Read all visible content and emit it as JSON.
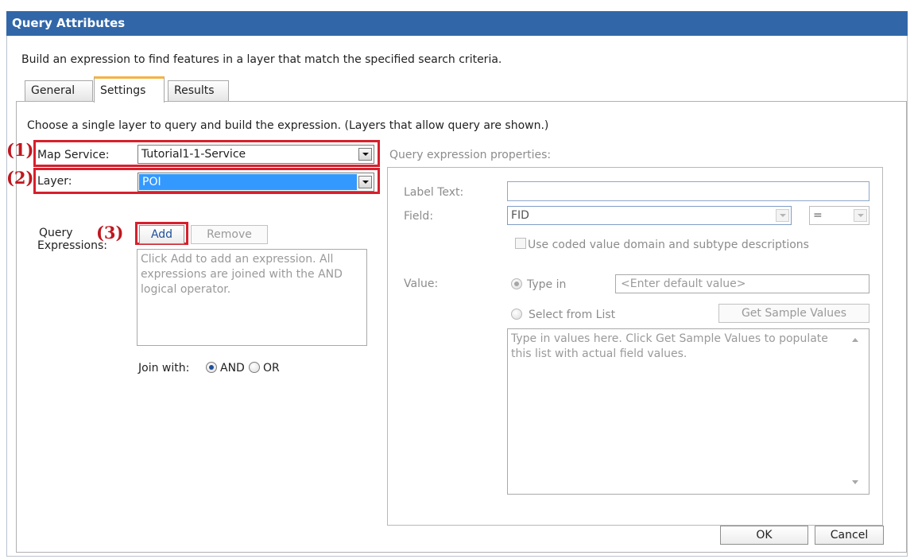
{
  "window": {
    "title": "Query Attributes"
  },
  "description": "Build an expression to find features in a layer that match the specified search criteria.",
  "tabs": [
    {
      "label": "General",
      "active": false
    },
    {
      "label": "Settings",
      "active": true
    },
    {
      "label": "Results",
      "active": false
    }
  ],
  "settings": {
    "instruction": "Choose a single layer to query and build the expression. (Layers that allow query are shown.)",
    "map_service": {
      "label": "Map Service:",
      "value": "Tutorial1-1-Service"
    },
    "layer": {
      "label": "Layer:",
      "value": "POI"
    },
    "query_expressions": {
      "label_line1": "Query",
      "label_line2": "Expressions:",
      "add_label": "Add",
      "remove_label": "Remove",
      "list_hint": "Click Add to add an expression. All expressions are joined with the AND logical operator.",
      "join_with_label": "Join with:",
      "join_options": [
        {
          "label": "AND",
          "selected": true
        },
        {
          "label": "OR",
          "selected": false
        }
      ]
    }
  },
  "properties": {
    "heading": "Query expression properties:",
    "label_text": {
      "label": "Label Text:",
      "value": ""
    },
    "field": {
      "label": "Field:",
      "value": "FID",
      "operator": "="
    },
    "coded_domain_label": "Use coded value domain and subtype descriptions",
    "value": {
      "label": "Value:",
      "type_in_label": "Type in",
      "default_placeholder": "<Enter default value>",
      "select_from_list_label": "Select from List",
      "get_sample_values_label": "Get Sample Values",
      "values_hint": "Type in values here. Click Get Sample Values to populate this list with actual field values."
    }
  },
  "annotations": [
    "(1)",
    "(2)",
    "(3)"
  ],
  "footer": {
    "ok_label": "OK",
    "cancel_label": "Cancel"
  },
  "colors": {
    "titlebar": "#3167a9",
    "highlight_box": "#d7202c",
    "selected_layer": "#3399ff",
    "active_tab_accent": "#f5b342"
  }
}
